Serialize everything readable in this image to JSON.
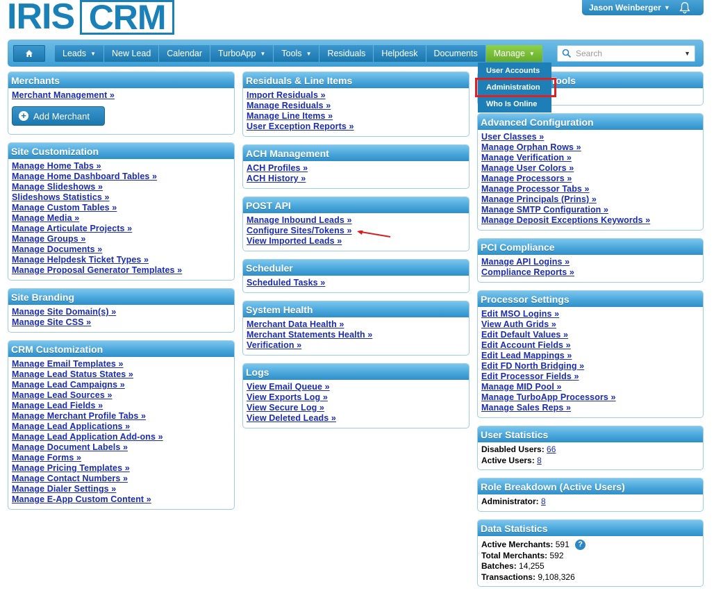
{
  "logo": {
    "part1": "IRIS",
    "part2": "CRM"
  },
  "user": {
    "name": "Jason Weinberger"
  },
  "nav": {
    "items": [
      {
        "label": "Leads",
        "caret": true
      },
      {
        "label": "New Lead",
        "caret": false
      },
      {
        "label": "Calendar",
        "caret": false
      },
      {
        "label": "TurboApp",
        "caret": true
      },
      {
        "label": "Tools",
        "caret": true
      },
      {
        "label": "Residuals",
        "caret": false
      },
      {
        "label": "Helpdesk",
        "caret": false
      },
      {
        "label": "Documents",
        "caret": false
      },
      {
        "label": "Manage",
        "caret": true,
        "active": true
      }
    ],
    "search_placeholder": "Search"
  },
  "manage_menu": [
    "User Accounts",
    "Administration",
    "Who Is Online"
  ],
  "panels": {
    "merchants": {
      "title": "Merchants",
      "links": [
        "Merchant Management »"
      ],
      "button": "Add Merchant"
    },
    "site_customization": {
      "title": "Site Customization",
      "links": [
        "Manage Home Tabs »",
        "Manage Home Dashboard Tables »",
        "Manage Slideshows »",
        "Slideshows Statistics »",
        "Manage Custom Tables »",
        "Manage Media »",
        "Manage Articulate Projects »",
        "Manage Groups »",
        "Manage Documents »",
        "Manage Helpdesk Ticket Types »",
        "Manage Proposal Generator Templates »"
      ]
    },
    "site_branding": {
      "title": "Site Branding",
      "links": [
        "Manage Site Domain(s) »",
        "Manage Site CSS »"
      ]
    },
    "crm_customization": {
      "title": "CRM Customization",
      "links": [
        "Manage Email Templates »",
        "Manage Lead Status States »",
        "Manage Lead Campaigns »",
        "Manage Lead Sources »",
        "Manage Lead Fields »",
        "Manage Merchant Profile Tabs »",
        "Manage Lead Applications »",
        "Manage Lead Application Add-ons »",
        "Manage Document Labels »",
        "Manage Forms »",
        "Manage Pricing Templates »",
        "Manage Contact Numbers »",
        "Manage Dialer Settings »",
        "Manage E-App Custom Content »"
      ]
    },
    "residuals": {
      "title": "Residuals & Line Items",
      "links": [
        "Import Residuals »",
        "Manage Residuals »",
        "Manage Line Items »",
        "User Exception Reports »"
      ]
    },
    "ach": {
      "title": "ACH Management",
      "links": [
        "ACH Profiles »",
        "ACH History »"
      ]
    },
    "post_api": {
      "title": "POST API",
      "links": [
        "Manage Inbound Leads »",
        "Configure Sites/Tokens »",
        "View Imported Leads »"
      ]
    },
    "scheduler": {
      "title": "Scheduler",
      "links": [
        "Scheduled Tasks »"
      ]
    },
    "system_health": {
      "title": "System Health",
      "links": [
        "Merchant Data Health »",
        "Merchant Statements Health »",
        "Verification »"
      ]
    },
    "logs": {
      "title": "Logs",
      "links": [
        "View Email Queue »",
        "View Exports Log »",
        "View Secure Log »",
        "View Deleted Leads »"
      ]
    },
    "tools": {
      "title": "Tools"
    },
    "advanced": {
      "title": "Advanced Configuration",
      "links": [
        "User Classes »",
        "Manage Orphan Rows »",
        "Manage Verification »",
        "Manage User Colors »",
        "Manage Processors »",
        "Manage Processor Tabs »",
        "Manage Principals (Prins) »",
        "Manage SMTP Configuration »",
        "Manage Deposit Exceptions Keywords »"
      ]
    },
    "pci": {
      "title": "PCI Compliance",
      "links": [
        "Manage API Logins »",
        "Compliance Reports »"
      ]
    },
    "processor": {
      "title": "Processor Settings",
      "links": [
        "Edit MSO Logins »",
        "View Auth Grids »",
        "Edit Default Values »",
        "Edit Account Fields »",
        "Edit Lead Mappings »",
        "Edit FD North Bridging »",
        "Edit Processor Fields »",
        "Manage MID Pool »",
        "Manage TurboApp Processors »",
        "Manage Sales Reps »"
      ]
    },
    "user_stats": {
      "title": "User Statistics",
      "disabled_label": "Disabled Users:",
      "disabled_value": "66",
      "active_label": "Active Users:",
      "active_value": "8"
    },
    "role": {
      "title": "Role Breakdown (Active Users)",
      "admin_label": "Administrator:",
      "admin_value": "8"
    },
    "data_stats": {
      "title": "Data Statistics",
      "rows": [
        {
          "label": "Active Merchants:",
          "value": "591"
        },
        {
          "label": "Total Merchants:",
          "value": "592"
        },
        {
          "label": "Batches:",
          "value": "14,255"
        },
        {
          "label": "Transactions:",
          "value": "9,108,326"
        }
      ]
    }
  }
}
